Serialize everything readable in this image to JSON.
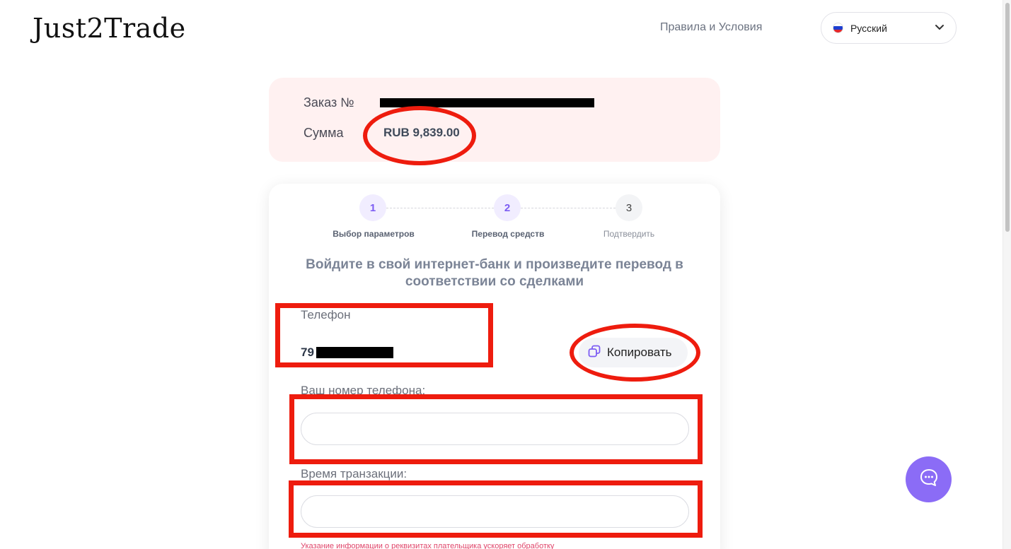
{
  "header": {
    "logo": "Just2Trade",
    "terms_link": "Правила и Условия",
    "language": {
      "selected": "Русский",
      "flag": "ru-flag"
    }
  },
  "order": {
    "order_label": "Заказ №",
    "amount_label": "Сумма",
    "amount_value": "RUB 9,839.00"
  },
  "steps": [
    {
      "number": "1",
      "label": "Выбор параметров",
      "state": "done"
    },
    {
      "number": "2",
      "label": "Перевод средств",
      "state": "active"
    },
    {
      "number": "3",
      "label": "Подтвердить",
      "state": "pending"
    }
  ],
  "transfer": {
    "instruction": "Войдите в свой интернет-банк и произведите перевод в соответствии со сделками",
    "phone_label": "Телефон",
    "phone_value_visible": "79",
    "copy_label": "Копировать",
    "your_phone_label": "Ваш номер телефона:",
    "transaction_time_label": "Время транзакции:",
    "hint": "Указание информации о реквизитах плательщика ускоряет обработку"
  },
  "colors": {
    "accent": "#7c5cf3",
    "chat_button": "#8b6cf6",
    "order_bg": "#fff1f1",
    "annotation_red": "#ee1c0e",
    "hint_red": "#e0456a"
  },
  "icons": [
    "chevron-down-icon",
    "copy-icon",
    "chat-icon"
  ]
}
